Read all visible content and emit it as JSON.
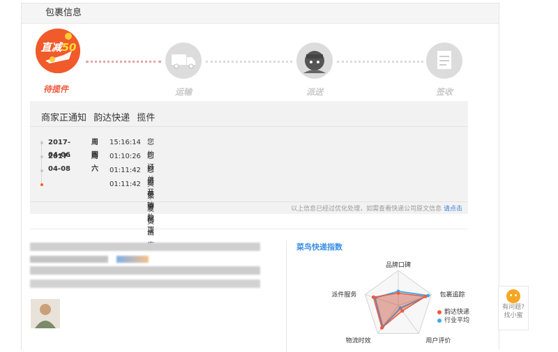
{
  "panel": {
    "title": "包裹信息"
  },
  "steps": [
    {
      "label": "待揽件",
      "badge_top": "直减",
      "badge_num": "50",
      "active": true
    },
    {
      "label": "运输",
      "active": false
    },
    {
      "label": "派送",
      "active": false
    },
    {
      "label": "签收",
      "active": false
    }
  ],
  "tracking": {
    "header": [
      "商家正通知",
      "韵达快递",
      "揽件"
    ],
    "rows": [
      {
        "date": "2017-04-06",
        "weekday": "周四",
        "time": "15:16:14",
        "message": "您的订单开始处理"
      },
      {
        "date": "2017-04-08",
        "weekday": "周六",
        "time": "01:10:26",
        "message": "您的订单待配货"
      },
      {
        "date": "",
        "weekday": "",
        "time": "01:11:42",
        "message": "您的包裹已出库"
      },
      {
        "date": "",
        "weekday": "",
        "time": "01:11:42",
        "message": "卖家发货"
      }
    ],
    "footer_text": "以上信息已经过优化处理，如需查看快递公司原文信息",
    "footer_link": "请点击"
  },
  "cainiao": {
    "title": "菜鸟快递指数",
    "axes": [
      "品牌口碑",
      "包裹追踪",
      "用户评价",
      "物流时效",
      "派件服务"
    ],
    "legend": [
      {
        "name": "韵达快递",
        "color": "#f05a3c"
      },
      {
        "name": "行业平均",
        "color": "#3aaaf0"
      }
    ],
    "chart_data": {
      "type": "radar",
      "categories": [
        "品牌口碑",
        "包裹追踪",
        "用户评价",
        "物流时效",
        "派件服务"
      ],
      "series": [
        {
          "name": "韵达快递",
          "values": [
            0.35,
            0.82,
            0.2,
            0.8,
            0.75
          ]
        },
        {
          "name": "行业平均",
          "values": [
            0.4,
            0.9,
            0.1,
            0.76,
            0.7
          ]
        }
      ],
      "ylim": [
        0,
        1
      ]
    }
  },
  "help": {
    "line1": "有问题?",
    "line2": "找小蜜"
  },
  "icons": [
    "truck-icon",
    "courier-icon",
    "receipt-icon",
    "promo-plane-icon"
  ]
}
